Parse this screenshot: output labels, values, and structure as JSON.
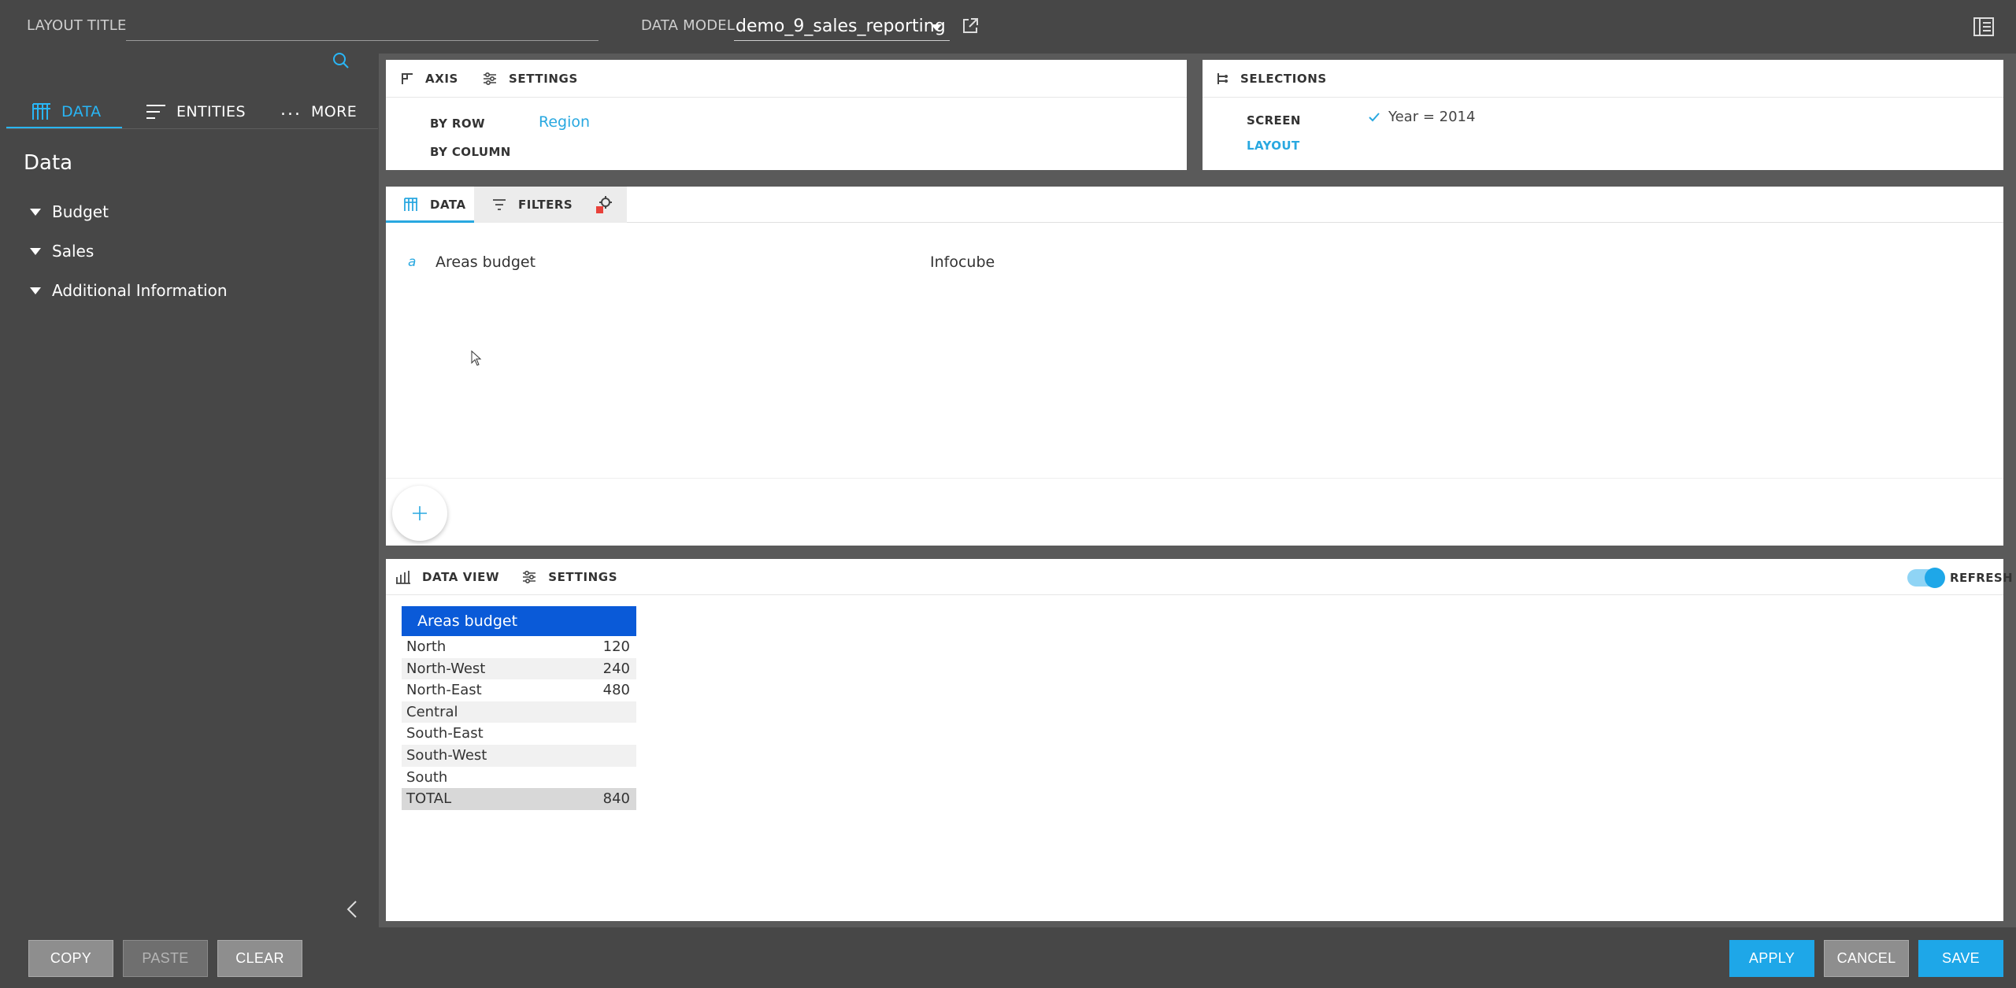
{
  "header": {
    "layout_title_label": "LAYOUT TITLE",
    "layout_title_value": "",
    "data_model_label": "DATA MODEL",
    "data_model_value": "demo_9_sales_reporting"
  },
  "sidebar": {
    "tabs": [
      {
        "label": "DATA",
        "icon": "data-grid-icon",
        "active": true
      },
      {
        "label": "ENTITIES",
        "icon": "entities-list-icon",
        "active": false
      },
      {
        "label": "MORE",
        "icon": "more-dots-icon",
        "active": false
      }
    ],
    "heading": "Data",
    "tree": [
      {
        "label": "Budget"
      },
      {
        "label": "Sales"
      },
      {
        "label": "Additional Information"
      }
    ]
  },
  "axis_panel": {
    "tabs": [
      {
        "label": "AXIS",
        "icon": "axis-icon"
      },
      {
        "label": "SETTINGS",
        "icon": "settings-sliders-icon"
      }
    ],
    "by_row_label": "BY ROW",
    "by_row_value": "Region",
    "by_column_label": "BY COLUMN"
  },
  "selections_panel": {
    "title": "SELECTIONS",
    "screen_label": "SCREEN",
    "screen_value": "Year = 2014",
    "layout_label": "LAYOUT"
  },
  "data_panel": {
    "tabs": [
      {
        "label": "DATA",
        "icon": "data-grid-icon"
      },
      {
        "label": "FILTERS",
        "icon": "filter-icon"
      }
    ],
    "rows": [
      {
        "type_letter": "a",
        "name": "Areas budget",
        "source": "Infocube"
      }
    ]
  },
  "data_view": {
    "tabs": [
      {
        "label": "DATA VIEW",
        "icon": "bar-chart-icon"
      },
      {
        "label": "SETTINGS",
        "icon": "settings-sliders-icon"
      }
    ],
    "refresh_label": "REFRESH",
    "refresh_on": true,
    "table_header": "Areas budget",
    "rows": [
      {
        "region": "North",
        "value": "120"
      },
      {
        "region": "North-West",
        "value": "240"
      },
      {
        "region": "North-East",
        "value": "480"
      },
      {
        "region": "Central",
        "value": ""
      },
      {
        "region": "South-East",
        "value": ""
      },
      {
        "region": "South-West",
        "value": ""
      },
      {
        "region": "South",
        "value": ""
      }
    ],
    "total_label": "TOTAL",
    "total_value": "840"
  },
  "footer": {
    "copy_label": "COPY",
    "paste_label": "PASTE",
    "clear_label": "CLEAR",
    "apply_label": "APPLY",
    "cancel_label": "CANCEL",
    "save_label": "SAVE"
  },
  "colors": {
    "accent": "#29b6f6",
    "table_header": "#0a5ad8",
    "background": "#474747",
    "button_blue": "#1ea7e8"
  }
}
